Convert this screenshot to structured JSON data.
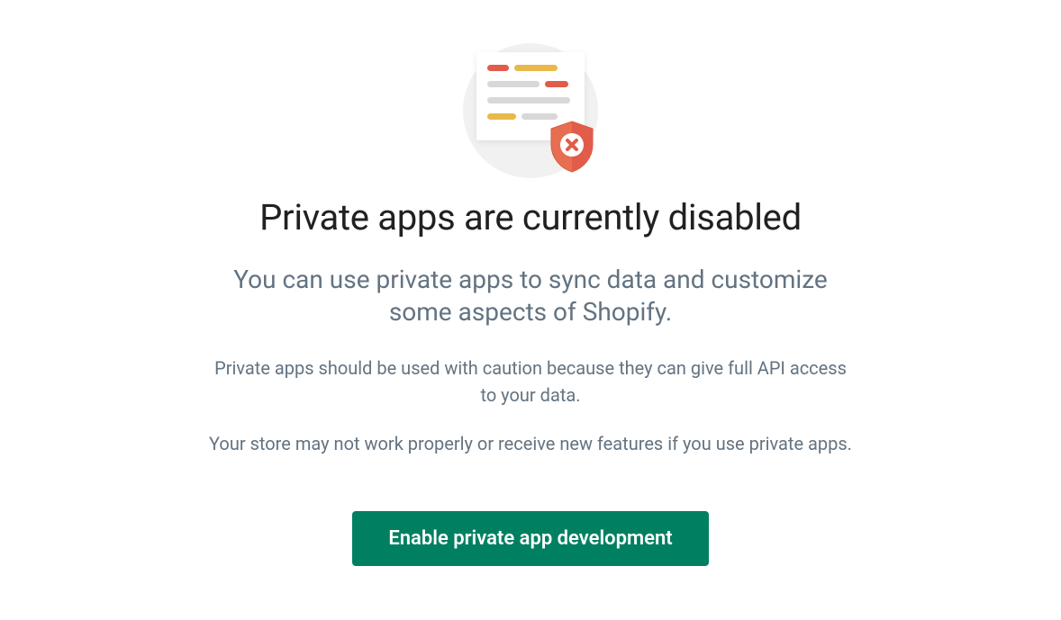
{
  "heading": "Private apps are currently disabled",
  "subheading": "You can use private apps to sync data and customize some aspects of Shopify.",
  "caution_text": "Private apps should be used with caution because they can give full API access to your data.",
  "warning_text": "Your store may not work properly or receive new features if you use private apps.",
  "button_label": "Enable private app development",
  "colors": {
    "primary": "#008060",
    "text_dark": "#212121",
    "text_muted": "#637381",
    "accent_red": "#e25c4a",
    "accent_yellow": "#e8b84a"
  }
}
